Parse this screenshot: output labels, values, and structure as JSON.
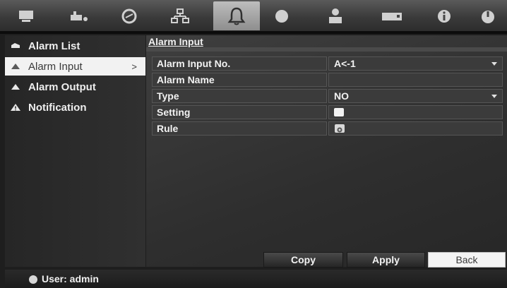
{
  "top_tabs": [
    {
      "name": "display-tab",
      "icon": "monitor-icon"
    },
    {
      "name": "camera-tab",
      "icon": "camera-icon"
    },
    {
      "name": "playback-tab",
      "icon": "clock-icon"
    },
    {
      "name": "network-tab",
      "icon": "network-icon"
    },
    {
      "name": "alarm-tab",
      "icon": "bell-icon",
      "active": true
    },
    {
      "name": "device-tab",
      "icon": "circle-icon"
    },
    {
      "name": "user-tab",
      "icon": "user-icon"
    },
    {
      "name": "storage-tab",
      "icon": "hdd-icon"
    },
    {
      "name": "info-tab",
      "icon": "info-icon"
    },
    {
      "name": "power-tab",
      "icon": "power-icon"
    }
  ],
  "sidebar": {
    "items": [
      {
        "label": "Alarm List"
      },
      {
        "label": "Alarm Input",
        "chevron": ">",
        "selected": true
      },
      {
        "label": "Alarm Output"
      },
      {
        "label": "Notification"
      }
    ]
  },
  "main": {
    "title": "Alarm Input",
    "rows": [
      {
        "label": "Alarm Input No.",
        "value": "A<-1"
      },
      {
        "label": "Alarm Name",
        "value": ""
      },
      {
        "label": "Type",
        "value": "NO"
      },
      {
        "label": "Setting"
      },
      {
        "label": "Rule"
      }
    ]
  },
  "buttons": {
    "copy": "Copy",
    "apply": "Apply",
    "back": "Back"
  },
  "status": {
    "user": "User: admin"
  }
}
